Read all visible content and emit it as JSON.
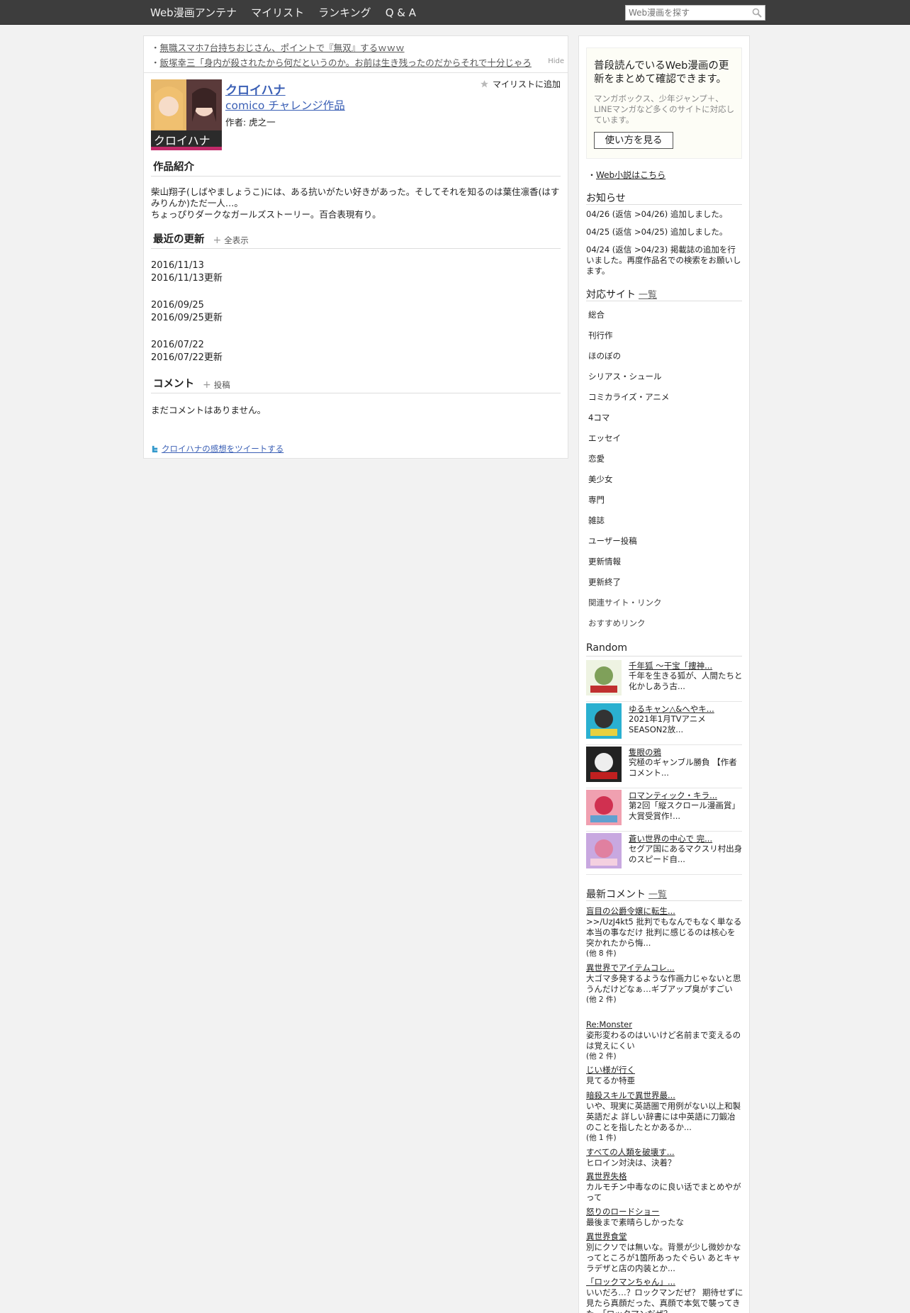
{
  "nav": {
    "brand": "Web漫画アンテナ",
    "items": [
      "マイリスト",
      "ランキング",
      "Q & A"
    ],
    "search_placeholder": "Web漫画を探す"
  },
  "news": {
    "items": [
      "無職スマホ7台持ちおじさん、ポイントで『無双』するｗｗｗ",
      "飯塚幸三「身内が殺されたから何だというのか。お前は生き残ったのだからそれで十分じゃろ"
    ],
    "hide_label": "Hide"
  },
  "work": {
    "title": "クロイハナ",
    "site": "comico チャレンジ作品",
    "author": "作者: 虎之一",
    "mylist_label": "マイリストに追加",
    "cover_text": "クロイハナ"
  },
  "intro": {
    "heading": "作品紹介",
    "text1": "柴山翔子(しばやましょうこ)には、ある抗いがたい好きがあった。そしてそれを知るのは葉住凛香(はすみりんか)ただ一人…。",
    "text2": "ちょっぴりダークなガールズストーリー。百合表現有り。"
  },
  "updates": {
    "heading": "最近の更新",
    "show_all": "全表示",
    "items": [
      {
        "date": "2016/11/13",
        "label": "2016/11/13更新"
      },
      {
        "date": "2016/09/25",
        "label": "2016/09/25更新"
      },
      {
        "date": "2016/07/22",
        "label": "2016/07/22更新"
      }
    ]
  },
  "comments": {
    "heading": "コメント",
    "post": "投稿",
    "empty": "まだコメントはありません。",
    "tweet": "クロイハナの感想をツイートする"
  },
  "sidebar": {
    "intro_title": "普段読んでいるWeb漫画の更新をまとめて確認できます。",
    "intro_desc": "マンガボックス、少年ジャンプ＋、LINEマンガなど多くのサイトに対応しています。",
    "intro_button": "使い方を見る",
    "novel_link": "Web小説はこちら",
    "notice_heading": "お知らせ",
    "notices": [
      "04/26 (返信 >04/26) 追加しました。",
      "04/25 (返信 >04/25) 追加しました。",
      "04/24 (返信 >04/23) 掲載誌の追加を行いました。再度作品名での検索をお願いします。"
    ],
    "sites_heading": "対応サイト",
    "sites_link": "一覧",
    "categories": [
      "総合",
      "刊行作",
      "ほのぼの",
      "シリアス・シュール",
      "コミカライズ・アニメ",
      "4コマ",
      "エッセイ",
      "恋愛",
      "美少女",
      "専門",
      "雑誌",
      "ユーザー投稿",
      "更新情報",
      "更新終了",
      "関連サイト・リンク",
      "おすすめリンク"
    ],
    "random_heading": "Random",
    "random": [
      {
        "title": "千年狐 ～干宝「捜神...",
        "desc": "千年を生きる狐が、人間たちと化かしあう古..."
      },
      {
        "title": "ゆるキャン△&へやキ...",
        "desc": "2021年1月TVアニメSEASON2放..."
      },
      {
        "title": "隻眼の鴉",
        "desc": "究極のギャンブル勝負 【作者コメント..."
      },
      {
        "title": "ロマンティック・キラ...",
        "desc": "第2回「縦スクロール漫画賞」大賞受賞作!..."
      },
      {
        "title": "蒼い世界の中心で 完...",
        "desc": "セグア国にあるマクスリ村出身のスピード自..."
      }
    ],
    "latest_heading": "最新コメント",
    "latest_link": "一覧",
    "latest": [
      {
        "title": "盲目の公爵令嬢に転生...",
        "text": ">>/UzJ4kt5 批判でもなんでもなく単なる本当の事なだけ 批判に感じるのは核心を突かれたから悔...",
        "count": "(他 8 件)"
      },
      {
        "title": "異世界でアイテムコレ...",
        "text": "大ゴマ多発するような作画力じゃないと思うんだけどなぁ…ギブアップ臭がすごい",
        "count": "(他 2 件)"
      },
      {
        "title": "Re:Monster",
        "text": "姿形変わるのはいいけど名前まで変えるのは覚えにくい",
        "count": "(他 2 件)"
      },
      {
        "title": "じい様が行く",
        "text": "見てるか特亜",
        "count": ""
      },
      {
        "title": "暗殺スキルで異世界最...",
        "text": "いや、現実に英語圏で用例がない以上和製英語だよ 詳しい辞書には中英語に刀鍛冶のことを指したとかあるか...",
        "count": "(他 1 件)"
      },
      {
        "title": "すべての人類を破壊す...",
        "text": "ヒロイン対決は、決着？",
        "count": ""
      },
      {
        "title": "異世界失格",
        "text": "カルモチン中毒なのに良い话でまとめやがって",
        "count": ""
      },
      {
        "title": "怒りのロードショー",
        "text": "最後まで素晴らしかったな",
        "count": ""
      },
      {
        "title": "異世界食堂",
        "text": "別にクソでは無いな。背景が少し微妙かなってところが1箇所あったぐらい あとキャラデザと店の内装とか...",
        "count": ""
      },
      {
        "title": "「ロックマンちゃん」...",
        "text": "いいだろ…？ロックマンだぜ？ 期待せずに見たら真顔だった、真顔で本気で襲ってきた。「ロックマンだぜ？",
        "count": ""
      }
    ]
  }
}
